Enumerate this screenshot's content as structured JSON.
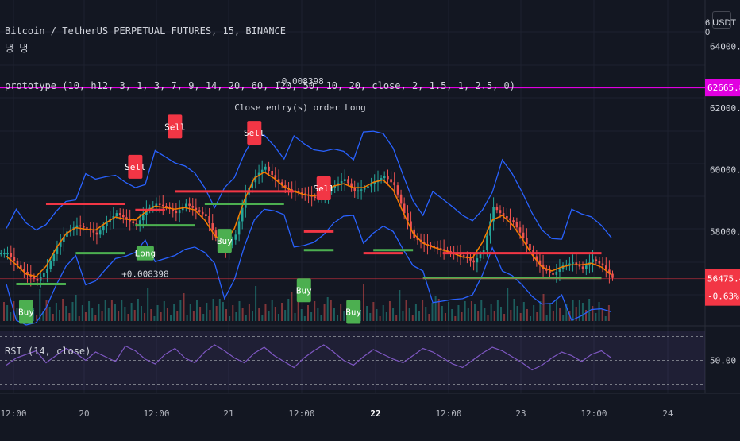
{
  "header": {
    "symbol_title": "Bitcoin / TetherUS PERPETUAL FUTURES, 15, BINANCE",
    "indicator_glyph": "냉 냉",
    "strategy_label": "prototype (10, h12, 3, 1, 3, 7, 9, 14, 20, 60, 120, 50, 10, 20, close, 2, 1.5, 1, 2.5, 0)",
    "unit_label": "6 USDT 0"
  },
  "price_axis": {
    "ticks": [
      "64000.00",
      "62000.00",
      "60000.00",
      "58000.00",
      "50.00"
    ],
    "alert_price": "62665.89",
    "last_price": "56475.45",
    "change_pct": "-0.63%"
  },
  "time_axis": {
    "ticks": [
      "12:00",
      "20",
      "12:00",
      "21",
      "12:00",
      "22",
      "12:00",
      "23",
      "12:00",
      "24"
    ]
  },
  "annotations": {
    "alert_line_text": "-0.008398",
    "close_order_text": "Close entry(s) order Long",
    "long_profit_text": "+0.008398",
    "long_label": "Long",
    "buy_label": "Buy",
    "sell_label": "Sell"
  },
  "rsi": {
    "label": "RSI (14, close)",
    "level": "50.00"
  },
  "colors": {
    "background": "#131722",
    "grid": "#1e2230",
    "candle_up": "#26a69a",
    "candle_down": "#ef5350",
    "bb_line": "#2962ff",
    "ema_line": "#f57c00",
    "stop_line_red": "#f23645",
    "stop_line_green": "#4caf50",
    "alert_line": "#e100e1",
    "rsi_line": "#7e57c2",
    "buy_badge": "#4caf50",
    "sell_badge": "#f23645"
  },
  "chart_data": {
    "type": "line",
    "series": [
      {
        "values": [
          57300,
          56900,
          56600,
          56400,
          56800,
          57500,
          58000,
          58200,
          58100,
          57900,
          58300,
          58600,
          58400,
          58200,
          58700,
          58900,
          58800,
          58600,
          58900,
          58700,
          58500,
          57800,
          57400,
          57900,
          59200,
          59800,
          60100,
          59700,
          59400,
          59300,
          59200,
          59100,
          59200,
          59500,
          59700,
          59300,
          59400,
          59600,
          59800,
          59500,
          58600,
          57800,
          57600,
          57500,
          57400,
          57300,
          57200,
          57000,
          57400,
          58800,
          58500,
          58300,
          57800,
          57200,
          56800,
          56600,
          56900,
          57000,
          56800,
          57100,
          56900,
          56500
        ]
      }
    ],
    "markers": [
      {
        "label": "Sell",
        "time_index": 13,
        "price": 60100
      },
      {
        "label": "Sell",
        "time_index": 17,
        "price": 61400
      },
      {
        "label": "Sell",
        "time_index": 25,
        "price": 61200
      },
      {
        "label": "Sell",
        "time_index": 32,
        "price": 59400
      },
      {
        "label": "Buy",
        "time_index": 2,
        "price": 55400
      },
      {
        "label": "Buy",
        "time_index": 22,
        "price": 57700
      },
      {
        "label": "Buy",
        "time_index": 30,
        "price": 56100
      },
      {
        "label": "Buy",
        "time_index": 35,
        "price": 55400
      },
      {
        "label": "Long",
        "time_index": 14,
        "price": 57300
      }
    ],
    "ylim": [
      55000,
      65500
    ],
    "rsi_ylim": [
      25,
      75
    ],
    "rsi_values": [
      46,
      52,
      55,
      58,
      48,
      54,
      60,
      56,
      50,
      57,
      53,
      49,
      62,
      58,
      51,
      47,
      55,
      60,
      52,
      48,
      57,
      63,
      58,
      52,
      48,
      56,
      61,
      54,
      49,
      44,
      52,
      58,
      63,
      57,
      50,
      46,
      53,
      59,
      55,
      51,
      48,
      54,
      60,
      57,
      52,
      47,
      44,
      50,
      56,
      61,
      58,
      53,
      48,
      42,
      46,
      52,
      57,
      54,
      49,
      55,
      58,
      52
    ]
  }
}
